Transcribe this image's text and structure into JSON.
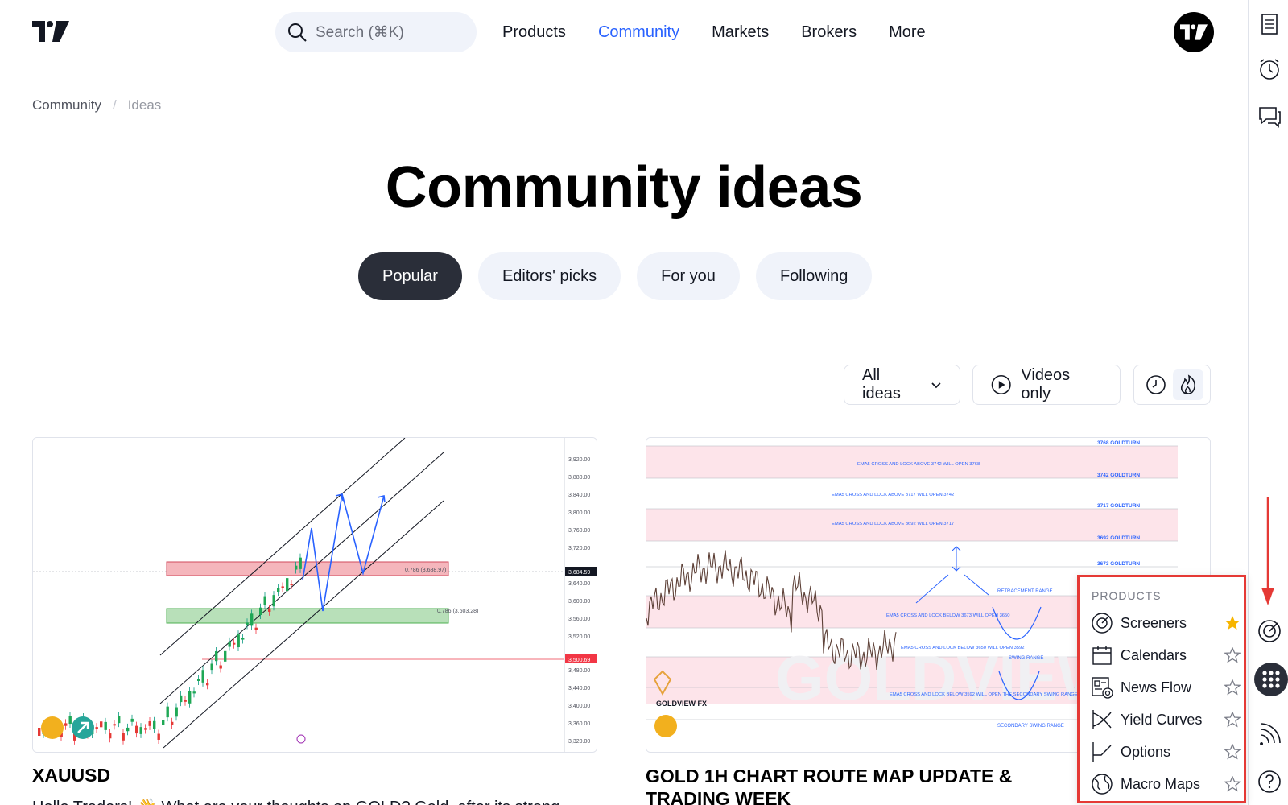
{
  "header": {
    "search_placeholder": "Search (⌘K)",
    "nav": [
      {
        "label": "Products",
        "active": false
      },
      {
        "label": "Community",
        "active": true
      },
      {
        "label": "Markets",
        "active": false
      },
      {
        "label": "Brokers",
        "active": false
      },
      {
        "label": "More",
        "active": false
      }
    ]
  },
  "breadcrumb": {
    "parent": "Community",
    "separator": "/",
    "current": "Ideas"
  },
  "page_title": "Community ideas",
  "tabs": [
    "Popular",
    "Editors' picks",
    "For you",
    "Following"
  ],
  "active_tab": "Popular",
  "filters": {
    "all_ideas": "All ideas",
    "videos_only": "Videos only"
  },
  "cards": [
    {
      "title": "XAUUSD",
      "description": "Hello Traders! 👋 What are your thoughts on GOLD? Gold, after its strong",
      "chart": {
        "price_axis": [
          "3,920.00",
          "3,880.00",
          "3,840.00",
          "3,800.00",
          "3,760.00",
          "3,720.00",
          "3,684.59",
          "3,640.00",
          "3,600.00",
          "3,560.00",
          "3,520.00",
          "3,500.69",
          "3,480.00",
          "3,440.00",
          "3,400.00",
          "3,360.00",
          "3,320.00"
        ],
        "zone_labels": [
          "0.786 (3,688.97)",
          "0.786 (3,603.28)"
        ]
      }
    },
    {
      "title": "GOLD 1H CHART ROUTE MAP UPDATE & TRADING WEEK",
      "chart": {
        "brand": "GOLDVIEW FX",
        "watermark": "GOLDVIEW",
        "levels": [
          "3768 GOLDTURN",
          "3742 GOLDTURN",
          "3717 GOLDTURN",
          "3692 GOLDTURN",
          "3673 GOLDTURN"
        ],
        "notes": [
          "EMA5 CROSS AND LOCK ABOVE 3742 WILL OPEN 3768",
          "EMA5 CROSS AND LOCK ABOVE 3717 WILL OPEN 3742",
          "EMA5 CROSS AND LOCK ABOVE 3692 WILL OPEN 3717",
          "EMA5 CROSS AND LOCK BELOW 3673 WILL OPEN 3650",
          "EMA5 CROSS AND LOCK BELOW 3650 WILL OPEN 3592",
          "EMA5 CROSS AND LOCK BELOW 3592 WILL OPEN THE SECONDARY SWING RANGE"
        ],
        "ranges": [
          "RETRACEMENT RANGE",
          "SWING RANGE",
          "SECONDARY SWING RANGE"
        ]
      }
    }
  ],
  "products_menu": {
    "heading": "PRODUCTS",
    "items": [
      {
        "label": "Screeners",
        "icon": "screener-icon",
        "favorite": true
      },
      {
        "label": "Calendars",
        "icon": "calendar-icon",
        "favorite": false
      },
      {
        "label": "News Flow",
        "icon": "news-flow-icon",
        "favorite": false
      },
      {
        "label": "Yield Curves",
        "icon": "yield-curve-icon",
        "favorite": false
      },
      {
        "label": "Options",
        "icon": "options-icon",
        "favorite": false
      },
      {
        "label": "Macro Maps",
        "icon": "globe-icon",
        "favorite": false
      }
    ]
  },
  "colors": {
    "accent": "#2962ff",
    "highlight_border": "#e53935",
    "star_filled": "#f7b500"
  }
}
